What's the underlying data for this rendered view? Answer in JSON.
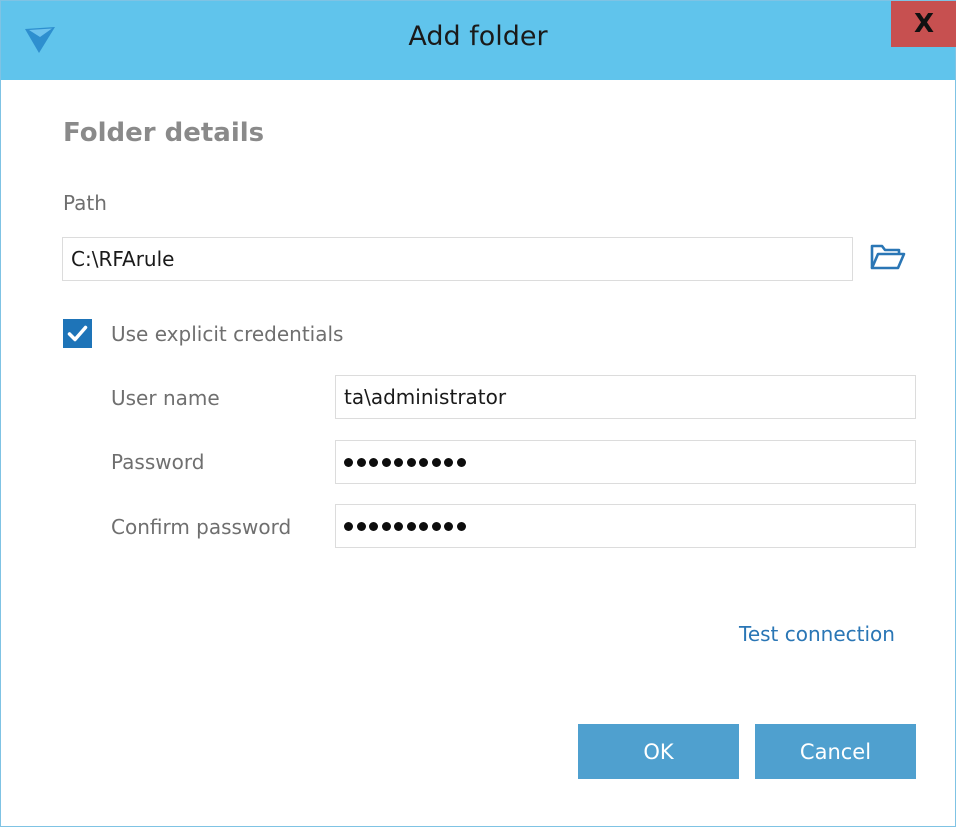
{
  "window": {
    "title": "Add folder",
    "close_label": "X"
  },
  "section": {
    "title": "Folder details"
  },
  "path": {
    "label": "Path",
    "value": "C:\\RFArule"
  },
  "credentials": {
    "checkbox_label": "Use explicit credentials",
    "checked": true,
    "username_label": "User name",
    "username_value": "ta\\administrator",
    "password_label": "Password",
    "password_length": 10,
    "confirm_label": "Confirm password",
    "confirm_length": 10
  },
  "test_connection_label": "Test connection",
  "buttons": {
    "ok_label": "OK",
    "cancel_label": "Cancel"
  },
  "colors": {
    "titlebar": "#60c4ec",
    "close": "#c75050",
    "accent": "#1e74b8",
    "button": "#4fa0cf",
    "link": "#2a76b5"
  },
  "icons": {
    "app": "app-logo-icon",
    "browse": "folder-open-icon",
    "check": "checkmark-icon"
  }
}
